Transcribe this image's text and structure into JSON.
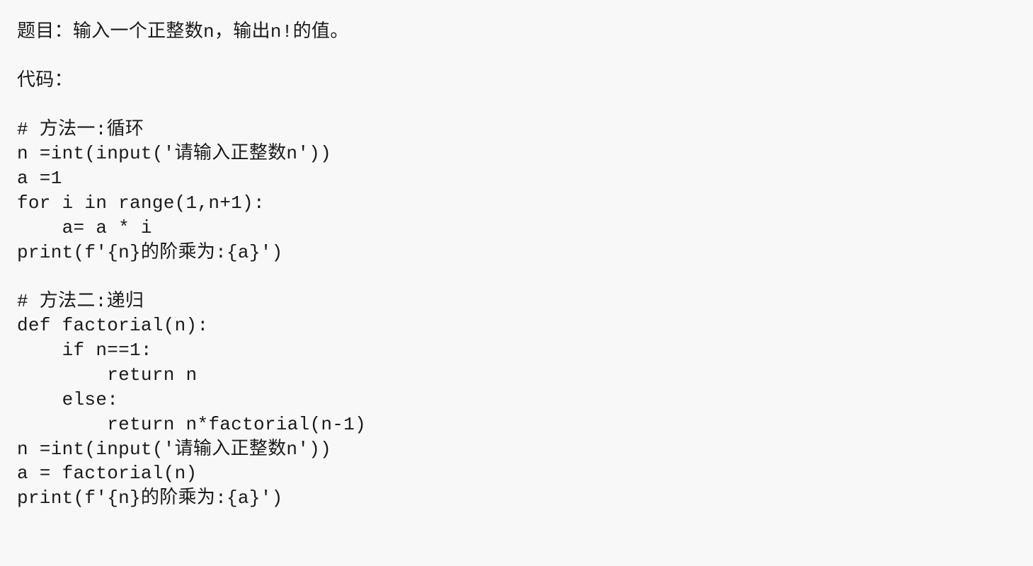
{
  "title": "题目：输入一个正整数n，输出n!的值。",
  "code_label": "代码：",
  "method1": {
    "comment": "# 方法一:循环",
    "lines": [
      "n =int(input('请输入正整数n'))",
      "a =1",
      "for i in range(1,n+1):",
      "    a= a * i",
      "print(f'{n}的阶乘为:{a}')"
    ]
  },
  "method2": {
    "comment": "# 方法二:递归",
    "lines": [
      "def factorial(n):",
      "    if n==1:",
      "        return n",
      "    else:",
      "        return n*factorial(n-1)",
      "n =int(input('请输入正整数n'))",
      "a = factorial(n)",
      "print(f'{n}的阶乘为:{a}')"
    ]
  }
}
